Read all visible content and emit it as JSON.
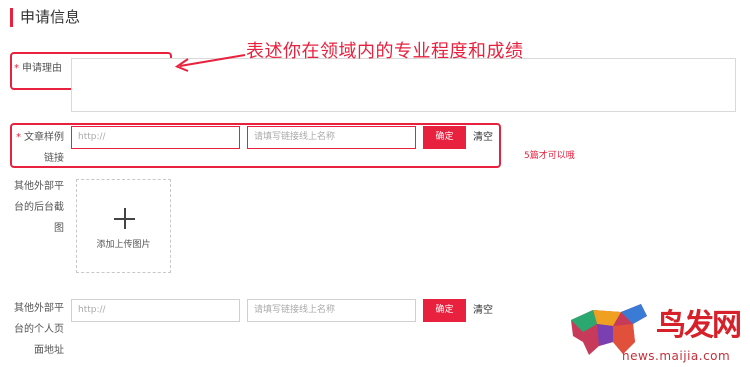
{
  "section": {
    "title": "申请信息"
  },
  "reason": {
    "required_mark": "*",
    "label": "申请理由",
    "value": ""
  },
  "article": {
    "required_mark": "*",
    "label_line1": "文章样例",
    "label_line2": "链接",
    "url_placeholder": "http://",
    "name_placeholder": "请填写链接线上名称",
    "confirm_label": "确定",
    "clear_label": "清空"
  },
  "backend_screenshot": {
    "label_line1": "其他外部平",
    "label_line2": "台的后台截",
    "label_line3": "图",
    "upload_label": "添加上传图片"
  },
  "homepage": {
    "label_line1": "其他外部平",
    "label_line2": "台的个人页",
    "label_line3": "面地址",
    "url_placeholder": "http://",
    "name_placeholder": "请填写链接线上名称",
    "confirm_label": "确定",
    "clear_label": "清空"
  },
  "annotations": {
    "reason_note": "表述你在领域内的专业程度和成绩",
    "article_note": "5篇才可以哦",
    "color": "#e8223e"
  },
  "watermark": {
    "logo_text": "鸟发网",
    "url": "news.maijia.com"
  }
}
